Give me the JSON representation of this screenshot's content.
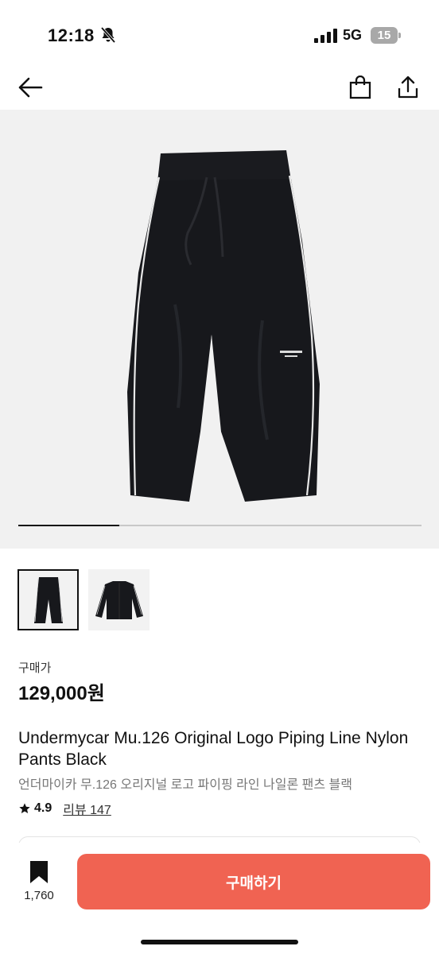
{
  "status_bar": {
    "time": "12:18",
    "network": "5G",
    "battery": "15",
    "icons": [
      "bell-slash-icon",
      "signal-icon",
      "battery-icon"
    ]
  },
  "top_nav": {
    "icons": [
      "back-arrow-icon",
      "shopping-bag-icon",
      "share-icon"
    ]
  },
  "gallery": {
    "current_index": 1,
    "total": 4,
    "progress_fraction": 0.25,
    "thumbnails": [
      "pants-thumbnail",
      "jacket-thumbnail"
    ]
  },
  "product": {
    "price_label": "구매가",
    "price": "129,000원",
    "title_en": "Undermycar Mu.126 Original Logo Piping Line Nylon Pants Black",
    "title_ko": "언더마이카 무.126 오리지널 로고 파이핑 라인 나일론 팬츠 블랙",
    "rating": "4.9",
    "review_label": "리뷰 147"
  },
  "bottom_bar": {
    "bookmark_count": "1,760",
    "buy_label": "구매하기",
    "buy_color": "#f06352"
  }
}
